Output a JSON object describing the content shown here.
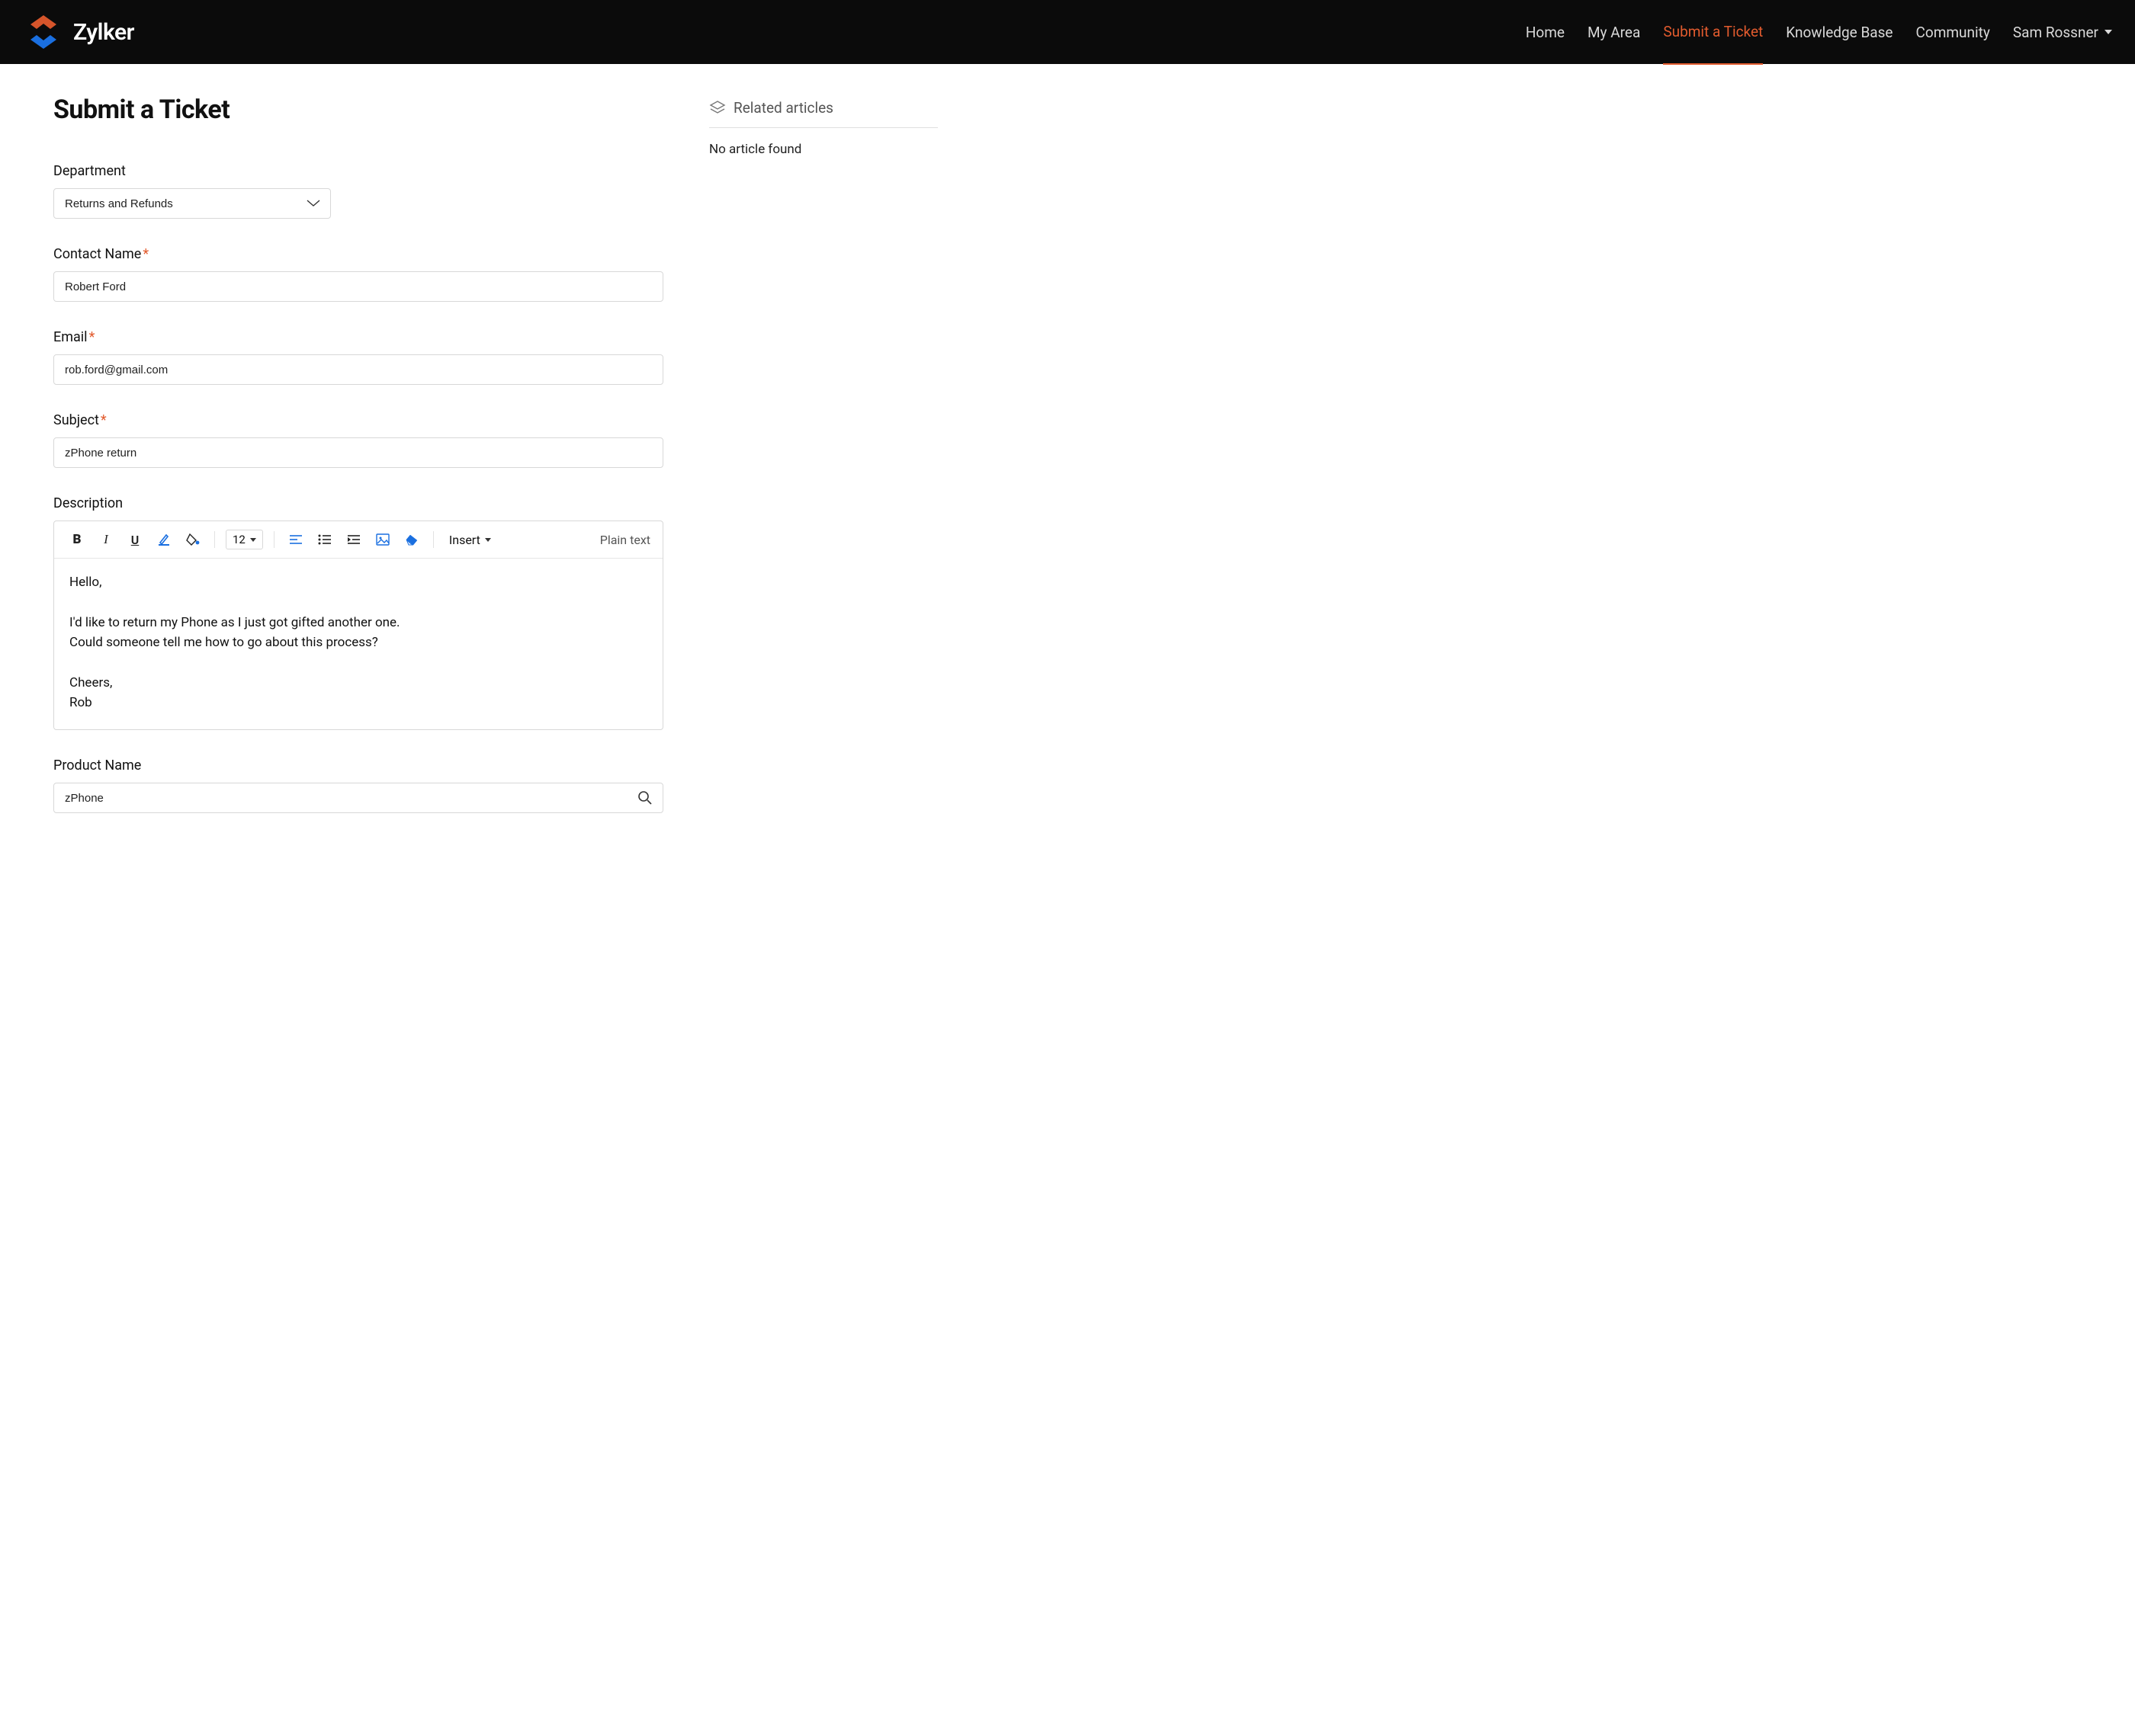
{
  "brand": {
    "name": "Zylker"
  },
  "nav": {
    "items": [
      {
        "label": "Home",
        "active": false
      },
      {
        "label": "My Area",
        "active": false
      },
      {
        "label": "Submit a Ticket",
        "active": true
      },
      {
        "label": "Knowledge Base",
        "active": false
      },
      {
        "label": "Community",
        "active": false
      }
    ],
    "user": "Sam Rossner"
  },
  "page": {
    "title": "Submit a Ticket"
  },
  "form": {
    "department": {
      "label": "Department",
      "value": "Returns and Refunds"
    },
    "contact_name": {
      "label": "Contact Name",
      "value": "Robert Ford"
    },
    "email": {
      "label": "Email",
      "value": "rob.ford@gmail.com"
    },
    "subject": {
      "label": "Subject",
      "value": "zPhone return"
    },
    "description": {
      "label": "Description",
      "value": "Hello,\n\nI'd like to return my Phone as I just got gifted another one.\nCould someone tell me how to go about this process?\n\nCheers,\nRob"
    },
    "product_name": {
      "label": "Product Name",
      "value": "zPhone"
    }
  },
  "editor_toolbar": {
    "font_size": "12",
    "insert_label": "Insert",
    "plain_text_label": "Plain text"
  },
  "sidebar": {
    "related_title": "Related articles",
    "empty_message": "No article found"
  }
}
